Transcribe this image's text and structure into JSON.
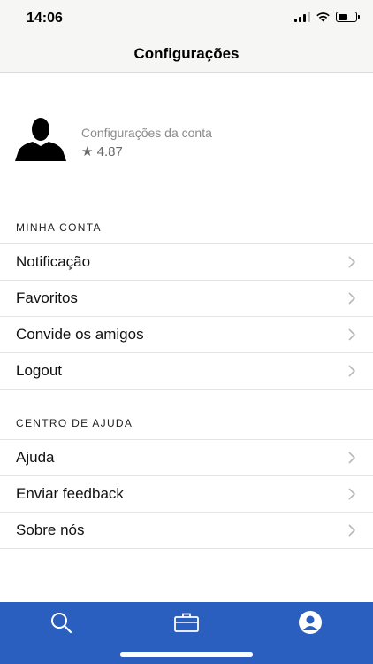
{
  "status_bar": {
    "time": "14:06"
  },
  "nav": {
    "title": "Configurações"
  },
  "profile": {
    "label": "Configurações da conta",
    "rating": "★ 4.87"
  },
  "sections": [
    {
      "header": "MINHA CONTA",
      "items": [
        {
          "label": "Notificação"
        },
        {
          "label": "Favoritos"
        },
        {
          "label": "Convide os amigos"
        },
        {
          "label": "Logout"
        }
      ]
    },
    {
      "header": "CENTRO DE AJUDA",
      "items": [
        {
          "label": "Ajuda"
        },
        {
          "label": "Enviar feedback"
        },
        {
          "label": "Sobre nós"
        }
      ]
    }
  ],
  "tab_bar": {
    "tabs": [
      {
        "icon": "search-icon"
      },
      {
        "icon": "briefcase-icon"
      },
      {
        "icon": "profile-icon",
        "active": true
      }
    ],
    "background": "#2a5fbf"
  }
}
